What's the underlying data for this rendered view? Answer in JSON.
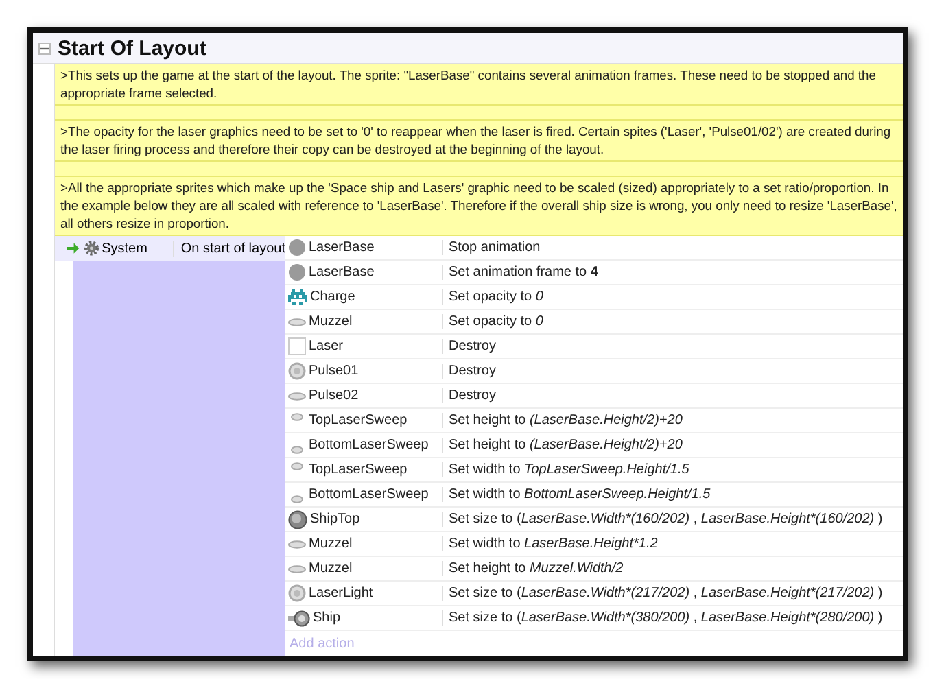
{
  "group": {
    "title": "Start Of Layout",
    "expanded": true
  },
  "comments": [
    ">This sets up the game at the start of the layout. The sprite: \"LaserBase\" contains several animation frames. These need to be stopped and the appropriate frame selected.",
    ">The opacity for the laser graphics need to be set to '0' to reappear when the laser is fired. Certain spites ('Laser', 'Pulse01/02') are created during the laser firing process and therefore their copy can be destroyed at the beginning of the layout.",
    ">All the appropriate sprites which make up the 'Space ship and Lasers' graphic need to be scaled (sized) appropriately to a set ratio/proportion. In the example below they are all scaled with reference to 'LaserBase'. Therefore if the overall ship size is wrong, you only need to resize 'LaserBase', all others resize in proportion."
  ],
  "event": {
    "condition": {
      "object": "System",
      "text": "On start of layout"
    },
    "actions": [
      {
        "kind": "sphere",
        "object": "LaserBase",
        "parts": [
          "Stop animation"
        ]
      },
      {
        "kind": "sphere",
        "object": "LaserBase",
        "parts": [
          "Set animation frame to **4**"
        ]
      },
      {
        "kind": "invader",
        "object": "Charge",
        "parts": [
          "Set opacity to ",
          "0"
        ]
      },
      {
        "kind": "lens",
        "object": "Muzzel",
        "parts": [
          "Set opacity to ",
          "0"
        ]
      },
      {
        "kind": "blank",
        "object": "Laser",
        "parts": [
          "Destroy"
        ]
      },
      {
        "kind": "ring",
        "object": "Pulse01",
        "parts": [
          "Destroy"
        ]
      },
      {
        "kind": "lens",
        "object": "Pulse02",
        "parts": [
          "Destroy"
        ]
      },
      {
        "kind": "sweep-top",
        "object": "TopLaserSweep",
        "parts": [
          "Set height to ",
          "(LaserBase.Height/2)+20"
        ]
      },
      {
        "kind": "sweep-bottom",
        "object": "BottomLaserSweep",
        "parts": [
          "Set height to ",
          "(LaserBase.Height/2)+20"
        ]
      },
      {
        "kind": "sweep-top",
        "object": "TopLaserSweep",
        "parts": [
          "Set width to ",
          "TopLaserSweep.Height/1.5"
        ]
      },
      {
        "kind": "sweep-bottom",
        "object": "BottomLaserSweep",
        "parts": [
          "Set width to ",
          "BottomLaserSweep.Height/1.5"
        ]
      },
      {
        "kind": "orb",
        "object": "ShipTop",
        "parts": [
          "Set size to (",
          "LaserBase.Width*(160/202)",
          " , ",
          "LaserBase.Height*(160/202)",
          " )"
        ]
      },
      {
        "kind": "lens",
        "object": "Muzzel",
        "parts": [
          "Set width to ",
          "LaserBase.Height*1.2"
        ]
      },
      {
        "kind": "lens",
        "object": "Muzzel",
        "parts": [
          "Set height to ",
          "Muzzel.Width/2"
        ]
      },
      {
        "kind": "ring",
        "object": "LaserLight",
        "parts": [
          "Set size to (",
          "LaserBase.Width*(217/202)",
          " , ",
          "LaserBase.Height*(217/202)",
          " )"
        ]
      },
      {
        "kind": "ship",
        "object": "Ship",
        "parts": [
          "Set size to (",
          "LaserBase.Width*(380/200)",
          " , ",
          "LaserBase.Height*(280/200)",
          " )"
        ]
      }
    ],
    "add_action": "Add action"
  }
}
